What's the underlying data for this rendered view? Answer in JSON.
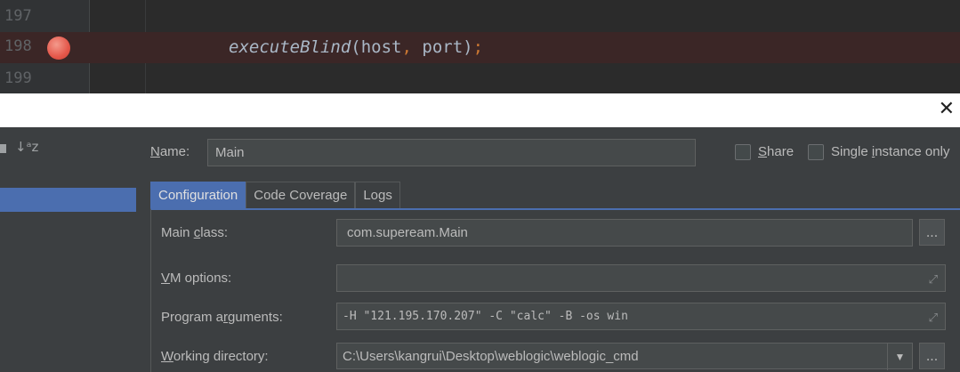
{
  "editor": {
    "lines": [
      {
        "number": "197",
        "code": ""
      },
      {
        "number": "198",
        "code": "executeBlind(host, port);",
        "breakpoint": true
      },
      {
        "number": "199",
        "code": ""
      }
    ],
    "code_fn": "executeBlind",
    "code_args": "(host",
    "code_comma": ",",
    "code_args2": " port)",
    "code_semicolon": ";"
  },
  "dialog": {
    "close_glyph": "✕"
  },
  "left_panel": {
    "sort_glyph": "↓ᵃz"
  },
  "form": {
    "name_label_prefix": "N",
    "name_label_rest": "ame:",
    "name_value": "Main",
    "share_label_prefix": "S",
    "share_label_rest": "hare",
    "single_label_prefix": "Single ",
    "single_label_mid": "i",
    "single_label_rest": "nstance only",
    "tabs": [
      {
        "label": "Configuration",
        "active": true
      },
      {
        "label": "Code Coverage",
        "active": false
      },
      {
        "label": "Logs",
        "active": false
      }
    ],
    "main_class_label_prefix": "Main ",
    "main_class_label_mid": "c",
    "main_class_label_rest": "lass:",
    "main_class_value": "com.supeream.Main",
    "browse_label": "...",
    "vm_label_prefix": "V",
    "vm_label_rest": "M options:",
    "vm_value": "",
    "program_label_prefix": "Program a",
    "program_label_mid": "r",
    "program_label_rest": "guments:",
    "program_value": "-H \"121.195.170.207\" -C \"calc\" -B -os win",
    "workdir_label_prefix": "W",
    "workdir_label_rest": "orking directory:",
    "workdir_value": "C:\\Users\\kangrui\\Desktop\\weblogic\\weblogic_cmd",
    "expand_glyph": "⤢",
    "dropdown_glyph": "▼"
  }
}
